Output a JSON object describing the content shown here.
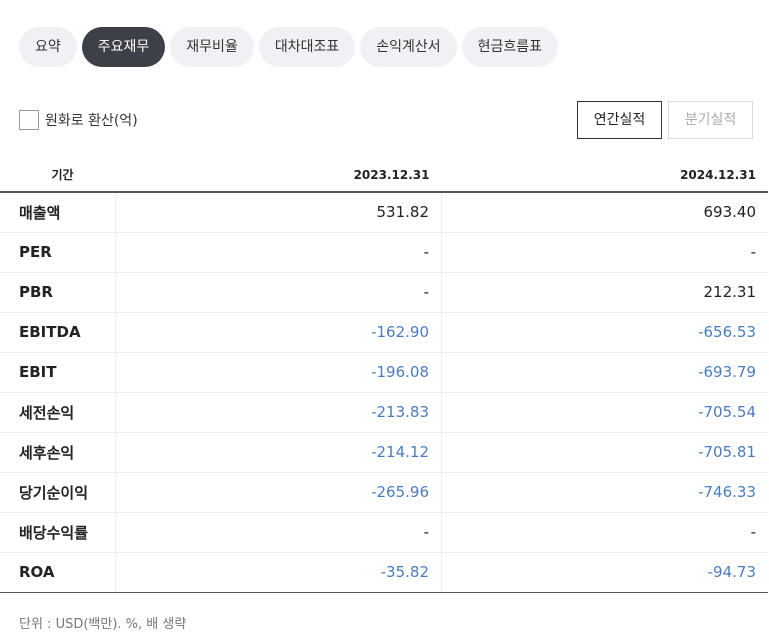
{
  "tabs": [
    "요약",
    "주요재무",
    "재무비율",
    "대차대조표",
    "손익계산서",
    "현금흐름표"
  ],
  "active_tab": 1,
  "currency_toggle": {
    "label": "원화로 환산(억)",
    "checked": false
  },
  "period_buttons": [
    {
      "label": "연간실적",
      "active": true
    },
    {
      "label": "분기실적",
      "active": false
    }
  ],
  "table": {
    "header_label": "기간",
    "columns": [
      "2023.12.31",
      "2024.12.31"
    ],
    "rows": [
      {
        "label": "매출액",
        "values": [
          "531.82",
          "693.40"
        ]
      },
      {
        "label": "PER",
        "values": [
          "-",
          "-"
        ]
      },
      {
        "label": "PBR",
        "values": [
          "-",
          "212.31"
        ]
      },
      {
        "label": "EBITDA",
        "values": [
          "-162.90",
          "-656.53"
        ]
      },
      {
        "label": "EBIT",
        "values": [
          "-196.08",
          "-693.79"
        ]
      },
      {
        "label": "세전손익",
        "values": [
          "-213.83",
          "-705.54"
        ]
      },
      {
        "label": "세후손익",
        "values": [
          "-214.12",
          "-705.81"
        ]
      },
      {
        "label": "당기순이익",
        "values": [
          "-265.96",
          "-746.33"
        ]
      },
      {
        "label": "배당수익률",
        "values": [
          "-",
          "-"
        ]
      },
      {
        "label": "ROA",
        "values": [
          "-35.82",
          "-94.73"
        ]
      }
    ]
  },
  "footnote": "단위 : USD(백만). %, 배 생략",
  "colors": {
    "negative": "#4a7cc4",
    "active_tab_bg": "#3d4046",
    "tab_bg": "#f0f1f4"
  }
}
